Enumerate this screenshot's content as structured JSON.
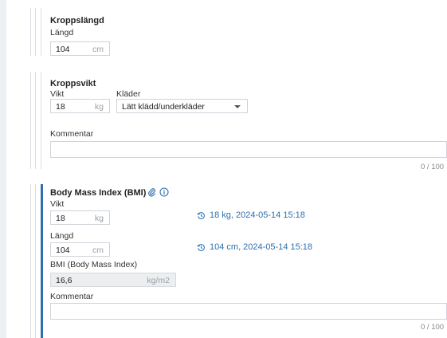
{
  "body_length": {
    "title": "Kroppslängd",
    "length_label": "Längd",
    "length_value": "104",
    "length_unit": "cm"
  },
  "body_weight": {
    "title": "Kroppsvikt",
    "weight_label": "Vikt",
    "weight_value": "18",
    "weight_unit": "kg",
    "clothes_label": "Kläder",
    "clothes_value": "Lätt klädd/underkläder",
    "comment_label": "Kommentar",
    "comment_counter": "0 / 100"
  },
  "bmi": {
    "title": "Body Mass Index (BMI)",
    "weight_label": "Vikt",
    "weight_value": "18",
    "weight_unit": "kg",
    "weight_history": "18 kg, 2024-05-14 15:18",
    "length_label": "Längd",
    "length_value": "104",
    "length_unit": "cm",
    "length_history": "104 cm, 2024-05-14 15:18",
    "bmi_label": "BMI (Body Mass Index)",
    "bmi_value": "16,6",
    "bmi_unit": "kg/m2",
    "comment_label": "Kommentar",
    "comment_counter": "0 / 100"
  },
  "colors": {
    "accent": "#2f6fae",
    "label": "#333333",
    "unit": "#9aa1a8"
  }
}
